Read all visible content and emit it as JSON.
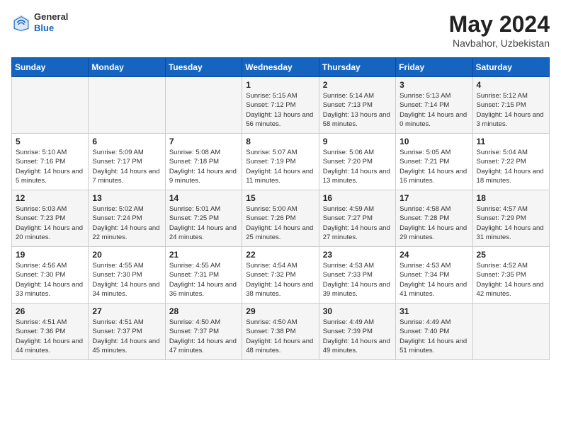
{
  "header": {
    "logo_general": "General",
    "logo_blue": "Blue",
    "title": "May 2024",
    "location": "Navbahor, Uzbekistan"
  },
  "days_of_week": [
    "Sunday",
    "Monday",
    "Tuesday",
    "Wednesday",
    "Thursday",
    "Friday",
    "Saturday"
  ],
  "weeks": [
    [
      {
        "day": "",
        "info": ""
      },
      {
        "day": "",
        "info": ""
      },
      {
        "day": "",
        "info": ""
      },
      {
        "day": "1",
        "info": "Sunrise: 5:15 AM\nSunset: 7:12 PM\nDaylight: 13 hours and 56 minutes."
      },
      {
        "day": "2",
        "info": "Sunrise: 5:14 AM\nSunset: 7:13 PM\nDaylight: 13 hours and 58 minutes."
      },
      {
        "day": "3",
        "info": "Sunrise: 5:13 AM\nSunset: 7:14 PM\nDaylight: 14 hours and 0 minutes."
      },
      {
        "day": "4",
        "info": "Sunrise: 5:12 AM\nSunset: 7:15 PM\nDaylight: 14 hours and 3 minutes."
      }
    ],
    [
      {
        "day": "5",
        "info": "Sunrise: 5:10 AM\nSunset: 7:16 PM\nDaylight: 14 hours and 5 minutes."
      },
      {
        "day": "6",
        "info": "Sunrise: 5:09 AM\nSunset: 7:17 PM\nDaylight: 14 hours and 7 minutes."
      },
      {
        "day": "7",
        "info": "Sunrise: 5:08 AM\nSunset: 7:18 PM\nDaylight: 14 hours and 9 minutes."
      },
      {
        "day": "8",
        "info": "Sunrise: 5:07 AM\nSunset: 7:19 PM\nDaylight: 14 hours and 11 minutes."
      },
      {
        "day": "9",
        "info": "Sunrise: 5:06 AM\nSunset: 7:20 PM\nDaylight: 14 hours and 13 minutes."
      },
      {
        "day": "10",
        "info": "Sunrise: 5:05 AM\nSunset: 7:21 PM\nDaylight: 14 hours and 16 minutes."
      },
      {
        "day": "11",
        "info": "Sunrise: 5:04 AM\nSunset: 7:22 PM\nDaylight: 14 hours and 18 minutes."
      }
    ],
    [
      {
        "day": "12",
        "info": "Sunrise: 5:03 AM\nSunset: 7:23 PM\nDaylight: 14 hours and 20 minutes."
      },
      {
        "day": "13",
        "info": "Sunrise: 5:02 AM\nSunset: 7:24 PM\nDaylight: 14 hours and 22 minutes."
      },
      {
        "day": "14",
        "info": "Sunrise: 5:01 AM\nSunset: 7:25 PM\nDaylight: 14 hours and 24 minutes."
      },
      {
        "day": "15",
        "info": "Sunrise: 5:00 AM\nSunset: 7:26 PM\nDaylight: 14 hours and 25 minutes."
      },
      {
        "day": "16",
        "info": "Sunrise: 4:59 AM\nSunset: 7:27 PM\nDaylight: 14 hours and 27 minutes."
      },
      {
        "day": "17",
        "info": "Sunrise: 4:58 AM\nSunset: 7:28 PM\nDaylight: 14 hours and 29 minutes."
      },
      {
        "day": "18",
        "info": "Sunrise: 4:57 AM\nSunset: 7:29 PM\nDaylight: 14 hours and 31 minutes."
      }
    ],
    [
      {
        "day": "19",
        "info": "Sunrise: 4:56 AM\nSunset: 7:30 PM\nDaylight: 14 hours and 33 minutes."
      },
      {
        "day": "20",
        "info": "Sunrise: 4:55 AM\nSunset: 7:30 PM\nDaylight: 14 hours and 34 minutes."
      },
      {
        "day": "21",
        "info": "Sunrise: 4:55 AM\nSunset: 7:31 PM\nDaylight: 14 hours and 36 minutes."
      },
      {
        "day": "22",
        "info": "Sunrise: 4:54 AM\nSunset: 7:32 PM\nDaylight: 14 hours and 38 minutes."
      },
      {
        "day": "23",
        "info": "Sunrise: 4:53 AM\nSunset: 7:33 PM\nDaylight: 14 hours and 39 minutes."
      },
      {
        "day": "24",
        "info": "Sunrise: 4:53 AM\nSunset: 7:34 PM\nDaylight: 14 hours and 41 minutes."
      },
      {
        "day": "25",
        "info": "Sunrise: 4:52 AM\nSunset: 7:35 PM\nDaylight: 14 hours and 42 minutes."
      }
    ],
    [
      {
        "day": "26",
        "info": "Sunrise: 4:51 AM\nSunset: 7:36 PM\nDaylight: 14 hours and 44 minutes."
      },
      {
        "day": "27",
        "info": "Sunrise: 4:51 AM\nSunset: 7:37 PM\nDaylight: 14 hours and 45 minutes."
      },
      {
        "day": "28",
        "info": "Sunrise: 4:50 AM\nSunset: 7:37 PM\nDaylight: 14 hours and 47 minutes."
      },
      {
        "day": "29",
        "info": "Sunrise: 4:50 AM\nSunset: 7:38 PM\nDaylight: 14 hours and 48 minutes."
      },
      {
        "day": "30",
        "info": "Sunrise: 4:49 AM\nSunset: 7:39 PM\nDaylight: 14 hours and 49 minutes."
      },
      {
        "day": "31",
        "info": "Sunrise: 4:49 AM\nSunset: 7:40 PM\nDaylight: 14 hours and 51 minutes."
      },
      {
        "day": "",
        "info": ""
      }
    ]
  ]
}
